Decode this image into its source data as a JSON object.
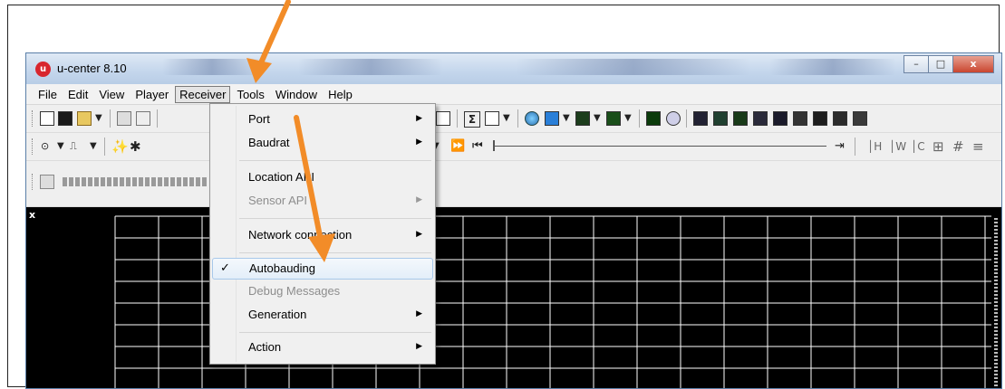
{
  "window": {
    "title": "u-center 8.10",
    "icon_glyph": "u",
    "controls": {
      "minimize": "–",
      "maximize": "□",
      "close": "x"
    }
  },
  "menubar": {
    "items": [
      "File",
      "Edit",
      "View",
      "Player",
      "Receiver",
      "Tools",
      "Window",
      "Help"
    ],
    "active": "Receiver"
  },
  "receiver_menu": {
    "items": [
      {
        "label": "Port",
        "submenu": true,
        "enabled": true
      },
      {
        "label": "Baudrat",
        "submenu": true,
        "enabled": true
      },
      {
        "label": "Location API",
        "submenu": false,
        "enabled": true
      },
      {
        "label": "Sensor API",
        "submenu": true,
        "enabled": false
      },
      {
        "label": "Network connection",
        "submenu": true,
        "enabled": true
      },
      {
        "label": "Autobauding",
        "submenu": false,
        "enabled": true,
        "checked": true
      },
      {
        "label": "Debug Messages",
        "submenu": false,
        "enabled": false
      },
      {
        "label": "Generation",
        "submenu": true,
        "enabled": true
      },
      {
        "label": "Action",
        "submenu": true,
        "enabled": true
      }
    ],
    "check_glyph": "✓",
    "submenu_glyph": "▶"
  },
  "toolbar": {
    "new_glyph": "🗋",
    "save_glyph": "💾",
    "open_glyph": "📂",
    "print_glyph": "🖨",
    "dropdown_glyph": "▼",
    "sigma_glyph": "Σ",
    "ff_glyph": "⏩",
    "skip_start_glyph": "⏮",
    "skip_end_glyph": "⇥",
    "plot_close_glyph": "x"
  },
  "colors": {
    "annotation_arrow": "#f28c28",
    "plot_background": "#000000",
    "grid": "#ffffff",
    "menu_highlight": "#e3eef9"
  },
  "icons": [
    "new-document-icon",
    "save-icon",
    "open-folder-icon",
    "print-icon",
    "print-preview-icon",
    "sigma-icon",
    "globe-icon",
    "fast-forward-icon",
    "skip-start-icon",
    "settings-icon"
  ]
}
